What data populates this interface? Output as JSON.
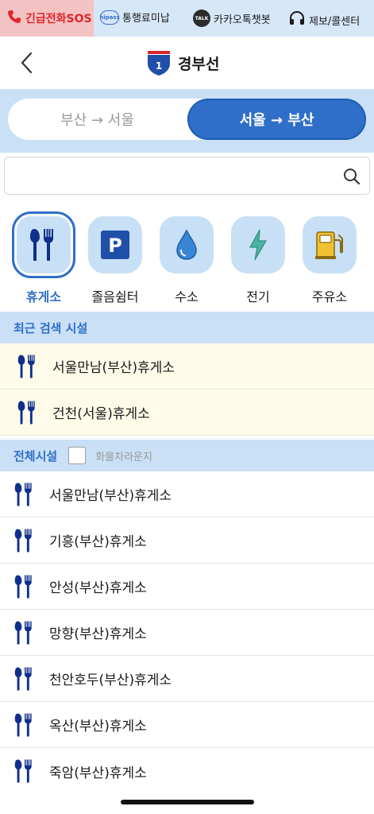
{
  "topbar": {
    "sos": "긴급전화SOS",
    "hipass_icon": "hipass",
    "unpaid": "통행료미납",
    "talk_icon": "TALK",
    "kakao": "카카오톡챗봇",
    "report": "제보/콜센터"
  },
  "header": {
    "title": "경부선",
    "route_number": "1"
  },
  "direction": {
    "left": "부산 → 서울",
    "right": "서울 → 부산",
    "selected": "right"
  },
  "search": {
    "value": "",
    "placeholder": ""
  },
  "categories": [
    {
      "label": "휴게소",
      "icon": "restaurant-icon",
      "active": true
    },
    {
      "label": "졸음쉼터",
      "icon": "parking-icon",
      "active": false
    },
    {
      "label": "수소",
      "icon": "water-drop-icon",
      "active": false
    },
    {
      "label": "전기",
      "icon": "lightning-icon",
      "active": false
    },
    {
      "label": "주유소",
      "icon": "fuel-pump-icon",
      "active": false
    }
  ],
  "recent": {
    "title": "최근 검색 시설",
    "items": [
      "서울만남(부산)휴게소",
      "건천(서울)휴게소"
    ]
  },
  "all": {
    "title": "전체시설",
    "checkbox_label": "화물차라운지",
    "items": [
      "서울만남(부산)휴게소",
      "기흥(부산)휴게소",
      "안성(부산)휴게소",
      "망향(부산)휴게소",
      "천안호두(부산)휴게소",
      "옥산(부산)휴게소",
      "죽암(부산)휴게소"
    ]
  },
  "colors": {
    "accent": "#2f6fc9",
    "light_blue": "#c9e0f6",
    "sos_red": "#e0262b",
    "recent_bg": "#fefbe8"
  }
}
